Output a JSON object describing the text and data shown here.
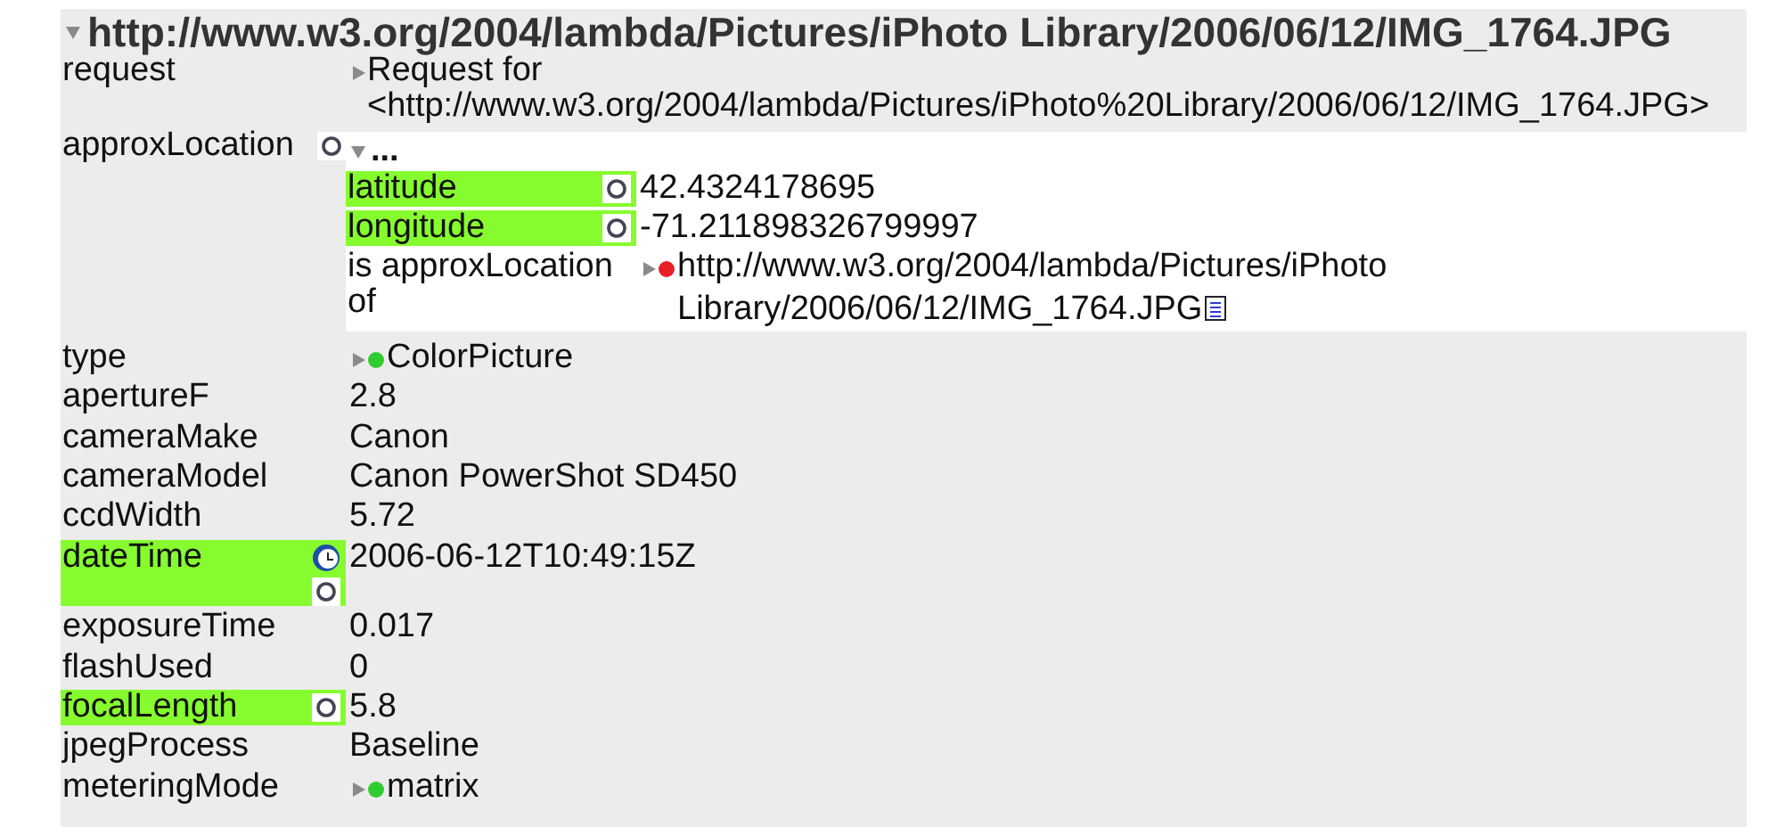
{
  "subject": {
    "expanded": true,
    "uri": "http://www.w3.org/2004/lambda/Pictures/iPhoto Library/2006/06/12/IMG_1764.JPG"
  },
  "properties": [
    {
      "label": "request",
      "value": {
        "kind": "node",
        "expanded": false,
        "text": "Request for <http://www.w3.org/2004/lambda/Pictures/iPhoto%20Library/2006/06/12/IMG_1764.JPG>"
      }
    },
    {
      "label": "approxLocation",
      "circle_button": true,
      "value": {
        "kind": "nested",
        "expanded": true,
        "text": "...",
        "properties": [
          {
            "label": "latitude",
            "highlighted": true,
            "circle_button": true,
            "value": {
              "kind": "text",
              "text": "42.4324178695"
            }
          },
          {
            "label": "longitude",
            "highlighted": true,
            "circle_button": true,
            "value": {
              "kind": "text",
              "text": "-71.211898326799997"
            }
          },
          {
            "label": "is approxLocation of",
            "value": {
              "kind": "node",
              "expanded": false,
              "color": "#e8202a",
              "document": true,
              "text": "http://www.w3.org/2004/lambda/Pictures/iPhoto Library/2006/06/12/IMG_1764.JPG"
            }
          }
        ]
      }
    },
    {
      "label": "type",
      "value": {
        "kind": "node",
        "expanded": false,
        "color": "#2ecc2e",
        "text": "ColorPicture"
      }
    },
    {
      "label": "apertureF",
      "value": {
        "kind": "text",
        "text": "2.8"
      }
    },
    {
      "label": "cameraMake",
      "value": {
        "kind": "text",
        "text": "Canon"
      }
    },
    {
      "label": "cameraModel",
      "value": {
        "kind": "text",
        "text": "Canon PowerShot SD450"
      }
    },
    {
      "label": "ccdWidth",
      "value": {
        "kind": "text",
        "text": "5.72"
      }
    },
    {
      "label": "dateTime",
      "highlighted": true,
      "clock_button": true,
      "circle_button": true,
      "value": {
        "kind": "text",
        "text": "2006-06-12T10:49:15Z"
      }
    },
    {
      "label": "exposureTime",
      "value": {
        "kind": "text",
        "text": "0.017"
      }
    },
    {
      "label": "flashUsed",
      "value": {
        "kind": "text",
        "text": "0"
      }
    },
    {
      "label": "focalLength",
      "highlighted": true,
      "circle_button": true,
      "value": {
        "kind": "text",
        "text": "5.8"
      }
    },
    {
      "label": "jpegProcess",
      "value": {
        "kind": "text",
        "text": "Baseline"
      }
    },
    {
      "label": "meteringMode",
      "value": {
        "kind": "node",
        "expanded": false,
        "color": "#2ecc2e",
        "text": "matrix"
      }
    }
  ]
}
